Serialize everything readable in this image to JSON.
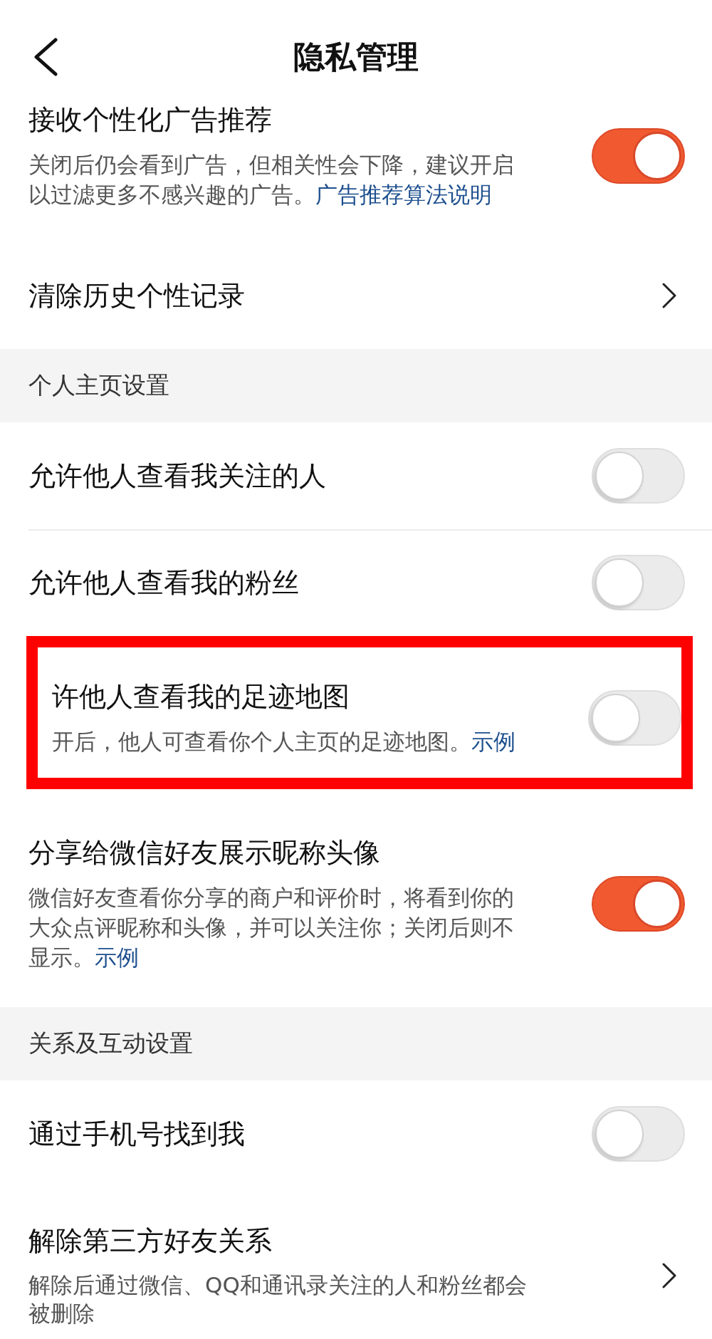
{
  "header": {
    "title": "隐私管理"
  },
  "sections": [
    {
      "items": [
        {
          "kind": "toggle",
          "title": "接收个性化广告推荐",
          "description": "关闭后仍会看到广告，但相关性会下降，建议开启以过滤更多不感兴趣的广告。",
          "link": "广告推荐算法说明",
          "on": true,
          "highlighted": false
        },
        {
          "kind": "link",
          "title": "清除历史个性记录",
          "highlighted": false
        }
      ]
    },
    {
      "heading": "个人主页设置",
      "items": [
        {
          "kind": "toggle",
          "title": "允许他人查看我关注的人",
          "on": false,
          "highlighted": false
        },
        {
          "kind": "toggle",
          "title": "允许他人查看我的粉丝",
          "on": false,
          "highlighted": false
        },
        {
          "kind": "toggle",
          "title": "许他人查看我的足迹地图",
          "description": "开后，他人可查看你个人主页的足迹地图。",
          "link": "示例",
          "on": false,
          "highlighted": true
        },
        {
          "kind": "toggle",
          "title": "分享给微信好友展示昵称头像",
          "description": "微信好友查看你分享的商户和评价时，将看到你的大众点评昵称和头像，并可以关注你；关闭后则不显示。",
          "link": "示例",
          "on": true,
          "highlighted": false
        }
      ]
    },
    {
      "heading": "关系及互动设置",
      "items": [
        {
          "kind": "toggle",
          "title": "通过手机号找到我",
          "on": false,
          "highlighted": false
        },
        {
          "kind": "link",
          "title": "解除第三方好友关系",
          "description": "解除后通过微信、QQ和通讯录关注的人和粉丝都会被删除",
          "highlighted": false
        }
      ]
    }
  ]
}
